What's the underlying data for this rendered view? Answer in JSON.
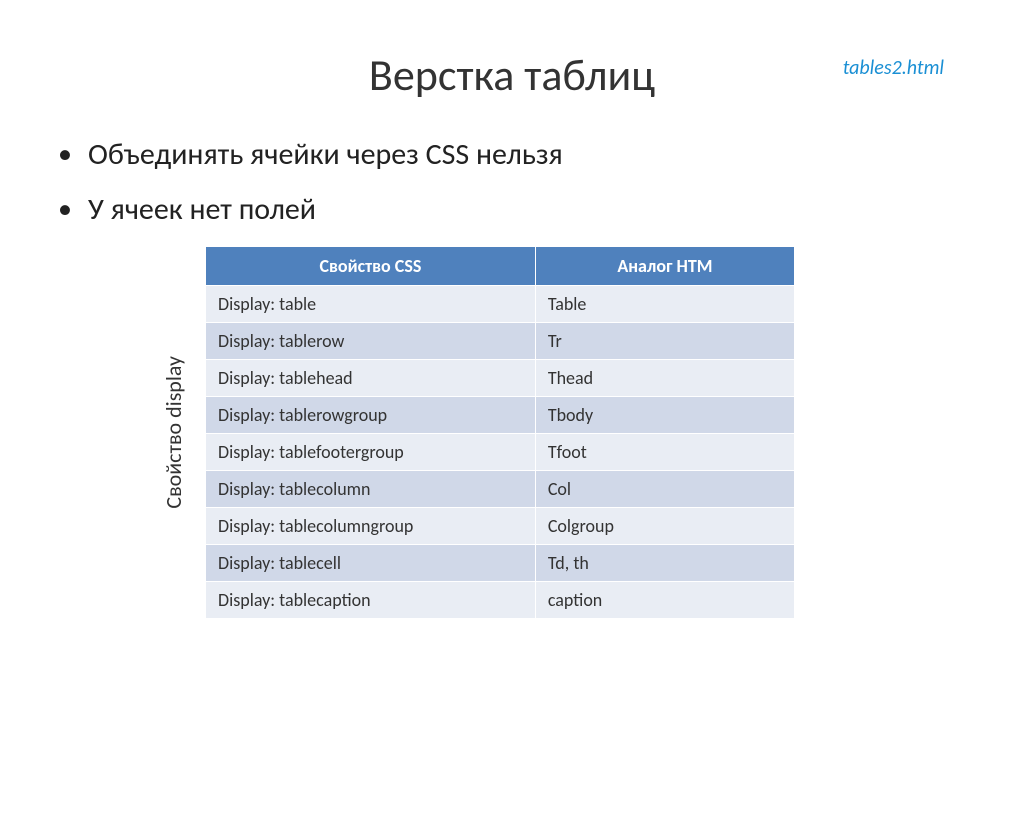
{
  "top_link": "tables2.html",
  "title": "Верстка таблиц",
  "bullets": [
    "Объединять ячейки через CSS нельзя",
    "У ячеек нет полей"
  ],
  "side_label": "Свойство display",
  "table": {
    "headers": [
      "Свойство CSS",
      "Аналог HTM"
    ],
    "rows": [
      [
        "Display: table",
        "Table"
      ],
      [
        "Display: tablerow",
        "Tr"
      ],
      [
        "Display: tablehead",
        "Thead"
      ],
      [
        "Display: tablerowgroup",
        "Tbody"
      ],
      [
        "Display: tablefootergroup",
        "Tfoot"
      ],
      [
        "Display: tablecolumn",
        "Col"
      ],
      [
        "Display: tablecolumngroup",
        "Colgroup"
      ],
      [
        "Display: tablecell",
        "Td, th"
      ],
      [
        "Display: tablecaption",
        "caption"
      ]
    ]
  }
}
